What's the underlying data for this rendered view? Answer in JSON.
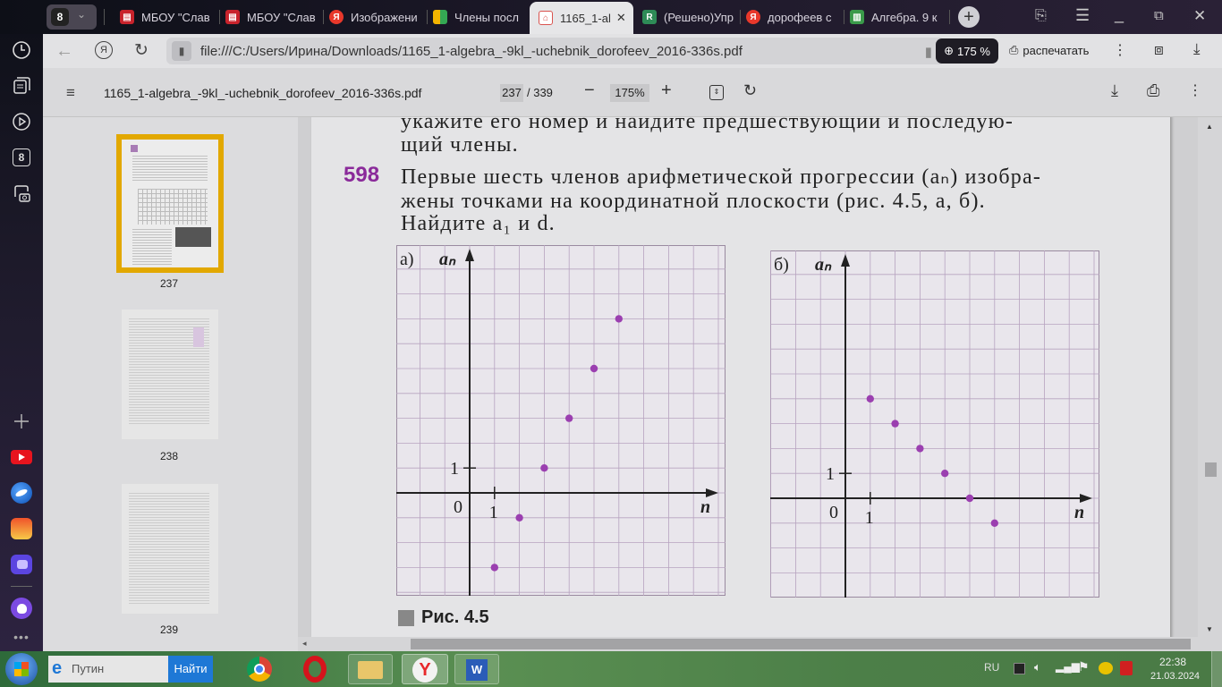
{
  "browser": {
    "profile_badge": "8",
    "tabs": [
      {
        "label": "МБОУ \"Слав",
        "icon": "doc-red-icon",
        "color": "#c8232c"
      },
      {
        "label": "МБОУ \"Слав",
        "icon": "doc-red-icon",
        "color": "#c8232c"
      },
      {
        "label": "Изображени",
        "icon": "yandex-icon",
        "color": "#e8382b"
      },
      {
        "label": "Члены посл",
        "icon": "grid-app-icon",
        "color": "#f4b400"
      },
      {
        "label": "1165_1-al",
        "icon": "pdf-icon",
        "color": "#d9534f",
        "active": true
      },
      {
        "label": "(Решено)Упр",
        "icon": "reshak-icon",
        "color": "#2e8b57"
      },
      {
        "label": "дорофеев с",
        "icon": "yandex-icon",
        "color": "#e8382b"
      },
      {
        "label": "Алгебра. 9 к",
        "icon": "book-icon",
        "color": "#3a9a4a"
      }
    ],
    "url": "file:///C:/Users/Ирина/Downloads/1165_1-algebra_-9kl_-uchebnik_dorofeev_2016-336s.pdf",
    "zoom_badge": "175 %",
    "print_label": "распечатать"
  },
  "pdf_toolbar": {
    "filename": "1165_1-algebra_-9kl_-uchebnik_dorofeev_2016-336s.pdf",
    "current_page": "237",
    "total_pages": "/ 339",
    "zoom": "175%"
  },
  "thumbnails": [
    {
      "page": "237",
      "selected": true
    },
    {
      "page": "238",
      "selected": false
    },
    {
      "page": "239",
      "selected": false
    }
  ],
  "document": {
    "prev_line1": "укажите его номер и найдите предшествующий и последую-",
    "prev_line2": "щий члены.",
    "exercise_number": "598",
    "line1": "Первые шесть членов арифметической прогрессии (aₙ) изобра-",
    "line2": "жены точками на координатной плоскости (рис. 4.5, а, б).",
    "line3": "Найдите a₁ и d.",
    "caption": "Рис. 4.5",
    "accent_color": "#8a2a9a",
    "point_color": "#9b3fb0"
  },
  "chart_data": [
    {
      "type": "scatter",
      "panel_label": "а)",
      "ylabel": "aₙ",
      "xlabel": "n",
      "origin_label": "0",
      "x_tick_label": "1",
      "y_tick_label": "1",
      "x": [
        1,
        2,
        3,
        4,
        5,
        6
      ],
      "y": [
        -3,
        -1,
        1,
        3,
        5,
        7
      ],
      "xlim": [
        -3,
        10
      ],
      "ylim": [
        -4,
        9
      ],
      "grid": true
    },
    {
      "type": "scatter",
      "panel_label": "б)",
      "ylabel": "aₙ",
      "xlabel": "n",
      "origin_label": "0",
      "x_tick_label": "1",
      "y_tick_label": "1",
      "x": [
        1,
        2,
        3,
        4,
        5,
        6
      ],
      "y": [
        4,
        3,
        2,
        1,
        0,
        -1
      ],
      "xlim": [
        -3,
        10
      ],
      "ylim": [
        -4,
        9
      ],
      "grid": true
    }
  ],
  "taskbar": {
    "search_value": "Путин",
    "search_button": "Найти",
    "language": "RU",
    "time": "22:38",
    "date": "21.03.2024"
  }
}
